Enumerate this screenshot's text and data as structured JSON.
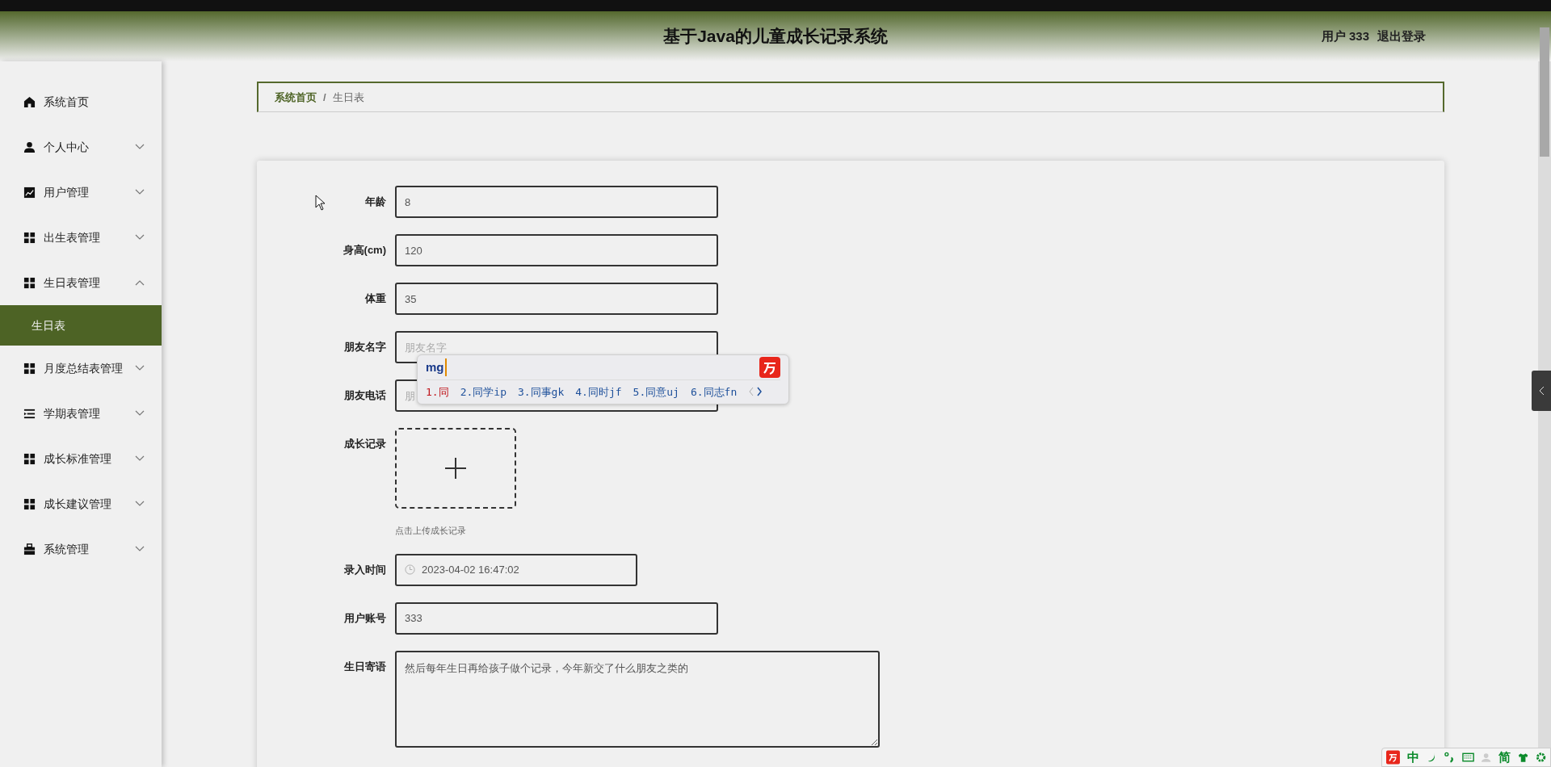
{
  "header": {
    "title": "基于Java的儿童成长记录系统",
    "user": "用户 333",
    "logout": "退出登录"
  },
  "sidebar": {
    "items": [
      {
        "label": "系统首页",
        "expandable": false
      },
      {
        "label": "个人中心",
        "expandable": true,
        "expanded": false
      },
      {
        "label": "用户管理",
        "expandable": true,
        "expanded": false
      },
      {
        "label": "出生表管理",
        "expandable": true,
        "expanded": false
      },
      {
        "label": "生日表管理",
        "expandable": true,
        "expanded": true,
        "children": [
          {
            "label": "生日表",
            "selected": true
          }
        ]
      },
      {
        "label": "月度总结表管理",
        "expandable": true,
        "expanded": false
      },
      {
        "label": "学期表管理",
        "expandable": true,
        "expanded": false
      },
      {
        "label": "成长标准管理",
        "expandable": true,
        "expanded": false
      },
      {
        "label": "成长建议管理",
        "expandable": true,
        "expanded": false
      },
      {
        "label": "系统管理",
        "expandable": true,
        "expanded": false
      }
    ]
  },
  "breadcrumb": {
    "items": [
      "系统首页",
      "生日表"
    ],
    "separator": "/"
  },
  "form": {
    "fields": [
      {
        "kind": "input",
        "label": "年龄",
        "value": "8"
      },
      {
        "kind": "input",
        "label": "身高(cm)",
        "value": "120"
      },
      {
        "kind": "input",
        "label": "体重",
        "value": "35"
      },
      {
        "kind": "input",
        "label": "朋友名字",
        "placeholder": "朋友名字"
      },
      {
        "kind": "input",
        "label": "朋友电话",
        "placeholder": "朋"
      },
      {
        "kind": "upload",
        "label": "成长记录",
        "hint": "点击上传成长记录"
      },
      {
        "kind": "datetime",
        "label": "录入时间",
        "value": "2023-04-02 16:47:02"
      },
      {
        "kind": "input",
        "label": "用户账号",
        "value": "333"
      },
      {
        "kind": "textarea",
        "label": "生日寄语",
        "value": "然后每年生日再给孩子做个记录，今年新交了什么朋友之类的"
      }
    ]
  },
  "ime": {
    "input": "mg",
    "candidates": [
      {
        "text": "1.同",
        "selected": true
      },
      {
        "text": "2.同学ip",
        "selected": false
      },
      {
        "text": "3.同事gk",
        "selected": false
      },
      {
        "text": "4.同时jf",
        "selected": false
      },
      {
        "text": "5.同意uj",
        "selected": false
      },
      {
        "text": "6.同志fn",
        "selected": false
      }
    ]
  },
  "ime_status": {
    "mode": "中",
    "script": "简"
  }
}
